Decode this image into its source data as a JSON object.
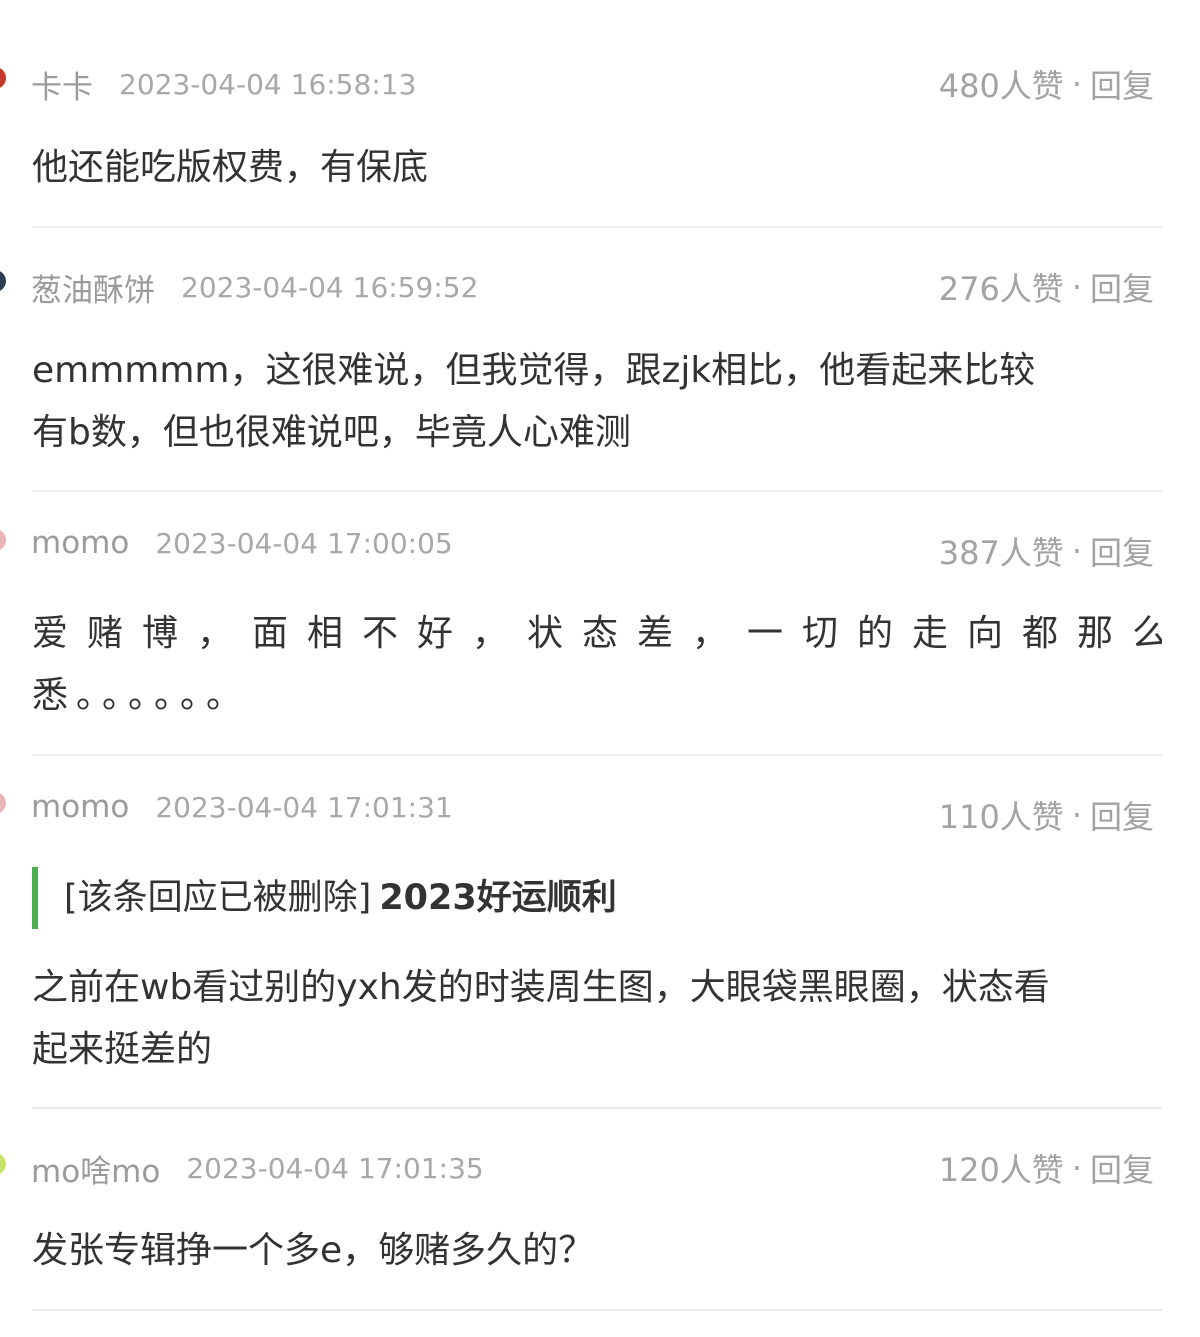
{
  "comments": [
    {
      "username": "卡卡",
      "timestamp": "2023-04-04 16:58:13",
      "likes": "480人赞",
      "separator": "·",
      "reply_label": "回复",
      "avatar_color": "#c0392b",
      "body_lines": [
        "他还能吃版权费，有保底"
      ]
    },
    {
      "username": "葱油酥饼",
      "timestamp": "2023-04-04 16:59:52",
      "likes": "276人赞",
      "separator": "·",
      "reply_label": "回复",
      "avatar_color": "#2c3e50",
      "body_lines": [
        "emmmmm，这很难说，但我觉得，跟zjk相比，他看起来比较",
        "有b数，但也很难说吧，毕竟人心难测"
      ]
    },
    {
      "username": "momo",
      "timestamp": "2023-04-04 17:00:05",
      "likes": "387人赞",
      "separator": "·",
      "reply_label": "回复",
      "avatar_color": "#e8b4b8",
      "body_lines": [
        "爱赌博，面相不好，状态差，一切的走向都那么熟",
        "悉。。。。。。"
      ]
    },
    {
      "username": "momo",
      "timestamp": "2023-04-04 17:01:31",
      "likes": "110人赞",
      "separator": "·",
      "reply_label": "回复",
      "avatar_color": "#e8b4b8",
      "quote_deleted": "[该条回应已被删除]",
      "quote_text": "2023好运顺利",
      "body_lines": [
        "之前在wb看过别的yxh发的时装周生图，大眼袋黑眼圈，状态看",
        "起来挺差的"
      ]
    },
    {
      "username": "mo啥mo",
      "timestamp": "2023-04-04 17:01:35",
      "likes": "120人赞",
      "separator": "·",
      "reply_label": "回复",
      "avatar_color": "#c6e36b",
      "body_lines": [
        "发张专辑挣一个多e，够赌多久的？"
      ]
    }
  ],
  "colors": {
    "quote_bar": "#4caf50",
    "meta_text": "#a3a3a3",
    "body_text": "#333333",
    "divider": "#ececec"
  }
}
